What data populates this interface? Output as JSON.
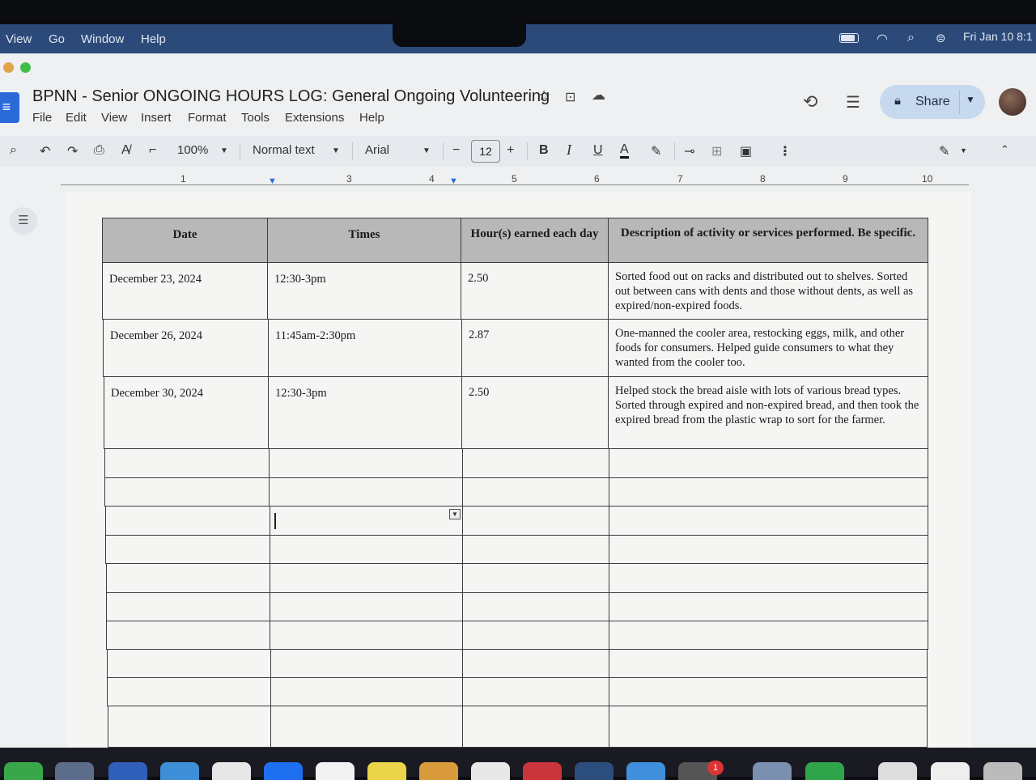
{
  "mac_menubar": {
    "items": [
      "View",
      "Go",
      "Window",
      "Help"
    ],
    "clock": "Fri Jan 10 8:1"
  },
  "doc": {
    "title": "BPNN - Senior ONGOING HOURS LOG: General Ongoing Volunteering",
    "menu": [
      "File",
      "Edit",
      "View",
      "Insert",
      "Format",
      "Tools",
      "Extensions",
      "Help"
    ],
    "share_label": "Share"
  },
  "toolbar": {
    "zoom": "100%",
    "style": "Normal text",
    "font": "Arial",
    "font_size": "12"
  },
  "ruler": {
    "numbers": [
      "1",
      "3",
      "4",
      "5",
      "6",
      "7",
      "8",
      "9",
      "10"
    ]
  },
  "table": {
    "headers": [
      "Date",
      "Times",
      "Hour(s) earned each day",
      "Description of activity or services performed. Be specific."
    ],
    "rows": [
      {
        "date": "December 23, 2024",
        "times": "12:30-3pm",
        "hours": "2.50",
        "description": "Sorted food out on racks and distributed out to shelves. Sorted out between cans with dents and those without dents, as well as expired/non-expired foods."
      },
      {
        "date": "December 26, 2024",
        "times": "11:45am-2:30pm",
        "hours": "2.87",
        "description": "One-manned the cooler area, restocking eggs, milk, and other foods for consumers. Helped guide consumers to what they wanted from the cooler too."
      },
      {
        "date": "December 30, 2024",
        "times": "12:30-3pm",
        "hours": "2.50",
        "description": "Helped stock the bread aisle with lots of various bread types. Sorted through expired and non-expired bread, and then took the expired bread from the plastic wrap to sort for the farmer."
      }
    ]
  },
  "dock": {
    "notification_badge": "1"
  },
  "colors": {
    "menubar": "#2c4a79",
    "share_button": "#c7d9ee",
    "table_header": "#b7b8b7",
    "docs_blue": "#2a6ad8"
  }
}
